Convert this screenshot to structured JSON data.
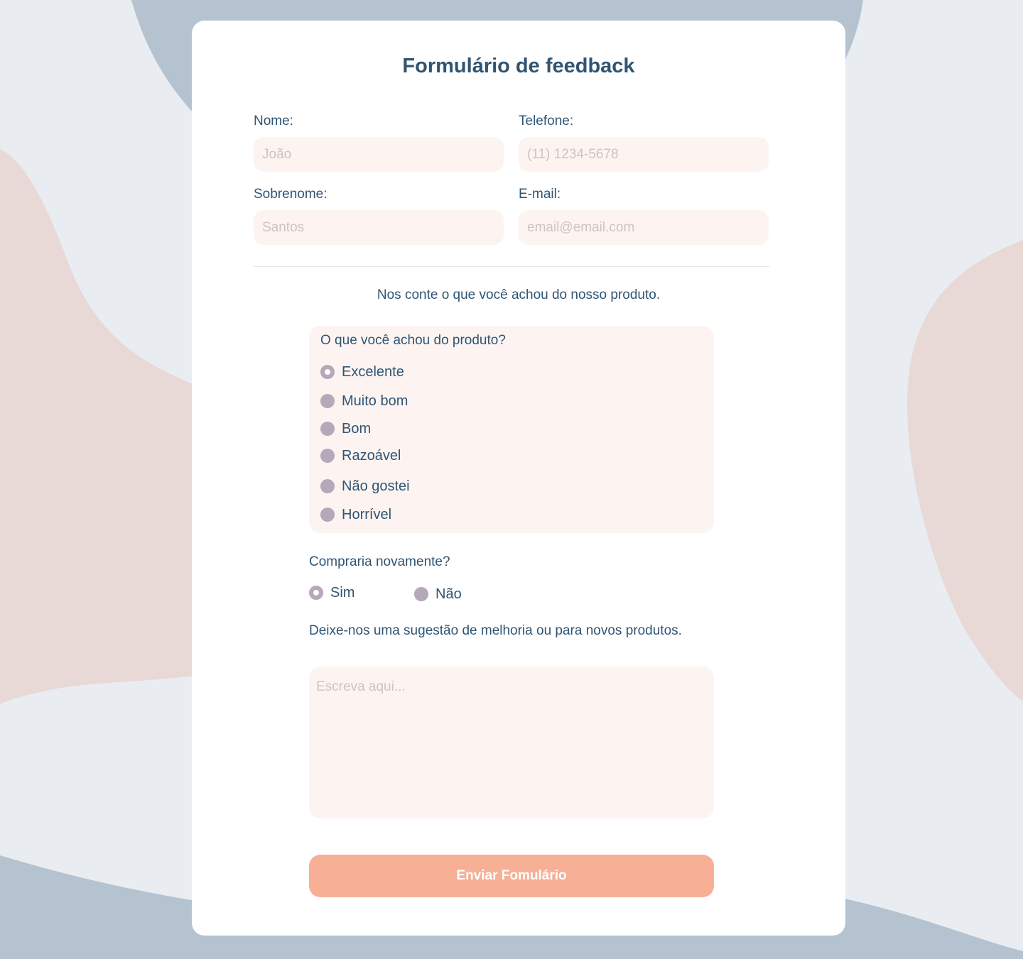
{
  "form": {
    "title": "Formulário de feedback",
    "fields": {
      "first_name": {
        "label": "Nome:",
        "placeholder": "João"
      },
      "phone": {
        "label": "Telefone:",
        "placeholder": "(11) 1234-5678"
      },
      "last_name": {
        "label": "Sobrenome:",
        "placeholder": "Santos"
      },
      "email": {
        "label": "E-mail:",
        "placeholder": "email@email.com"
      }
    },
    "intro": "Nos conte o que você achou do nosso produto.",
    "rating": {
      "question": "O que você achou do produto?",
      "selected": "Excelente",
      "options": [
        "Excelente",
        "Muito bom",
        "Bom",
        "Razoável",
        "Não gostei",
        "Horrível"
      ]
    },
    "buy_again": {
      "question": "Compraria novamente?",
      "selected": "Sim",
      "options": [
        "Sim",
        "Não"
      ]
    },
    "suggestion": {
      "question": "Deixe-nos uma sugestão de melhoria ou para novos produtos.",
      "placeholder": "Escreva aqui..."
    },
    "submit_label": "Enviar Fomulário"
  },
  "colors": {
    "background": "#e9edf1",
    "blob_blue": "#b5c3d0",
    "blob_pink": "#e8d9d7",
    "card": "#ffffff",
    "text": "#2f5574",
    "field_bg": "#fdf4f1",
    "radio": "#b5a8b8",
    "button": "#f7b096"
  }
}
